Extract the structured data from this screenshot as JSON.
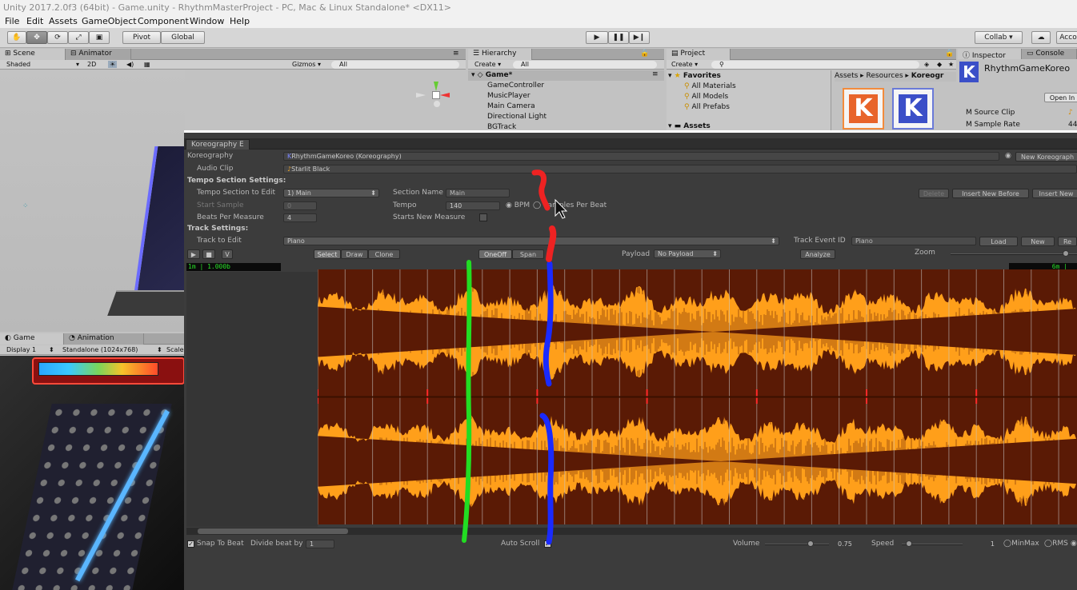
{
  "window": {
    "title": "Unity 2017.2.0f3 (64bit) - Game.unity - RhythmMasterProject - PC, Mac & Linux Standalone* <DX11>"
  },
  "menu": [
    "File",
    "Edit",
    "Assets",
    "GameObject",
    "Component",
    "Window",
    "Help"
  ],
  "toolbar": {
    "pivot": "Pivot",
    "global": "Global",
    "collab": "Collab ▾",
    "account": "Acco"
  },
  "scene": {
    "tab": "Scene",
    "tab2": "Animator",
    "shading": "Shaded",
    "mode2d": "2D",
    "gizmos": "Gizmos ▾",
    "search": "All"
  },
  "game": {
    "tab": "Game",
    "tab2": "Animation",
    "display": "Display 1",
    "resolution": "Standalone (1024x768)",
    "scale": "Scale"
  },
  "hierarchy": {
    "tab": "Hierarchy",
    "create": "Create ▾",
    "search": "All",
    "root": "Game*",
    "items": [
      "GameController",
      "MusicPlayer",
      "Main Camera",
      "Directional Light",
      "BGTrack"
    ]
  },
  "project": {
    "tab": "Project",
    "create": "Create ▾",
    "favorites": "Favorites",
    "fav_items": [
      "All Materials",
      "All Models",
      "All Prefabs"
    ],
    "assets": "Assets",
    "breadcrumb": [
      "Assets",
      "Resources",
      "Koreogr"
    ]
  },
  "inspector": {
    "tab": "Inspector",
    "tab2": "Console",
    "object": "RhythmGameKoreo",
    "open": "Open In",
    "fields": [
      {
        "label": "M Source Clip",
        "value": ""
      },
      {
        "label": "M Sample Rate",
        "value": "44"
      }
    ]
  },
  "koreo": {
    "tab": "Koreography E",
    "koreography_label": "Koreography",
    "koreography_value": "RhythmGameKoreo (Koreography)",
    "new_koreography": "New Koreograph",
    "audio_clip_label": "Audio Clip",
    "audio_clip_value": "Starlit Black",
    "tempo_header": "Tempo Section Settings:",
    "tempo_section_label": "Tempo Section to Edit",
    "tempo_section_value": "1) Main",
    "section_name_label": "Section Name",
    "section_name_value": "Main",
    "delete": "Delete",
    "insert_before": "Insert New Before",
    "insert_after": "Insert New",
    "start_sample_label": "Start Sample",
    "start_sample_value": "0",
    "tempo_label": "Tempo",
    "tempo_value": "140",
    "bpm": "BPM",
    "samples_per_beat": "Samples Per Beat",
    "beats_per_measure_label": "Beats Per Measure",
    "beats_per_measure_value": "4",
    "starts_new_measure_label": "Starts New Measure",
    "track_header": "Track Settings:",
    "track_label": "Track to Edit",
    "track_value": "Piano",
    "event_id_label": "Track Event ID",
    "event_id_value": "Piano",
    "load": "Load",
    "new": "New",
    "re": "Re",
    "play_v": "V",
    "modes": [
      "Select",
      "Draw",
      "Clone"
    ],
    "oneoff": "OneOff",
    "span": "Span",
    "payload_label": "Payload",
    "payload_value": "No Payload",
    "analyze": "Analyze",
    "zoom_label": "Zoom",
    "time_left": "1m | 1.000b",
    "time_right": "6m |",
    "snap_label": "Snap To Beat",
    "divide_label": "Divide beat by",
    "divide_value": "1",
    "auto_scroll": "Auto Scroll",
    "volume_label": "Volume",
    "volume_value": "0.75",
    "volume_level": 0.75,
    "speed_label": "Speed",
    "speed_value": "1",
    "minmax": "MinMax",
    "rms": "RMS"
  },
  "colors": {
    "wave_light": "#ff9f1a",
    "wave_dark": "#5a1a05",
    "beat_line": "#c8c8c8",
    "measure_line": "#ff2a2a",
    "mark_green": "#22dd22",
    "mark_blue": "#1a2aff",
    "mark_red": "#ee2222"
  }
}
